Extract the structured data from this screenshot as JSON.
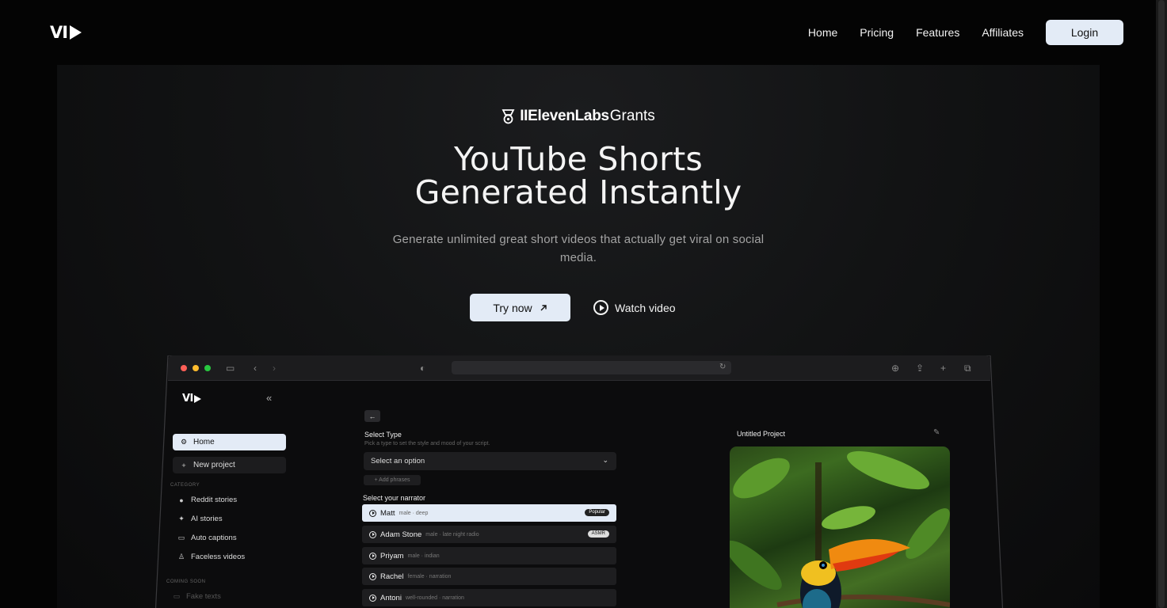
{
  "nav": {
    "logo": "VI",
    "links": [
      "Home",
      "Pricing",
      "Features",
      "Affiliates"
    ],
    "login": "Login"
  },
  "hero": {
    "badge_brand": "IIElevenLabs",
    "badge_suffix": "Grants",
    "headline_line1": "YouTube Shorts",
    "headline_line2": "Generated Instantly",
    "subline": "Generate unlimited great short videos that actually get viral on social media.",
    "try_now": "Try now",
    "watch_video": "Watch video"
  },
  "app": {
    "logo": "VI",
    "sidebar": {
      "home": "Home",
      "new_project": "New project",
      "category_caption": "CATEGORY",
      "items": [
        "Reddit stories",
        "AI stories",
        "Auto captions",
        "Faceless videos"
      ],
      "coming_soon_caption": "COMING SOON",
      "coming_soon_items": [
        "Fake texts"
      ]
    },
    "form": {
      "select_type_label": "Select Type",
      "select_type_hint": "Pick a type to set the style and mood of your script.",
      "select_placeholder": "Select an option",
      "add_phrases": "+ Add phrases",
      "narrator_label": "Select your narrator",
      "narrators": [
        {
          "name": "Matt",
          "desc": "male · deep",
          "tag": "Popular"
        },
        {
          "name": "Adam Stone",
          "desc": "male · late night radio",
          "tag": "ASMR"
        },
        {
          "name": "Priyam",
          "desc": "male · indian",
          "tag": ""
        },
        {
          "name": "Rachel",
          "desc": "female · narration",
          "tag": ""
        },
        {
          "name": "Antoni",
          "desc": "well-rounded · narration",
          "tag": ""
        }
      ]
    },
    "project": {
      "title": "Untitled Project"
    }
  },
  "colors": {
    "accent": "#e3ebf6",
    "background": "#040404",
    "traffic_red": "#ff5f57",
    "traffic_yellow": "#febc2e",
    "traffic_green": "#28c840"
  }
}
